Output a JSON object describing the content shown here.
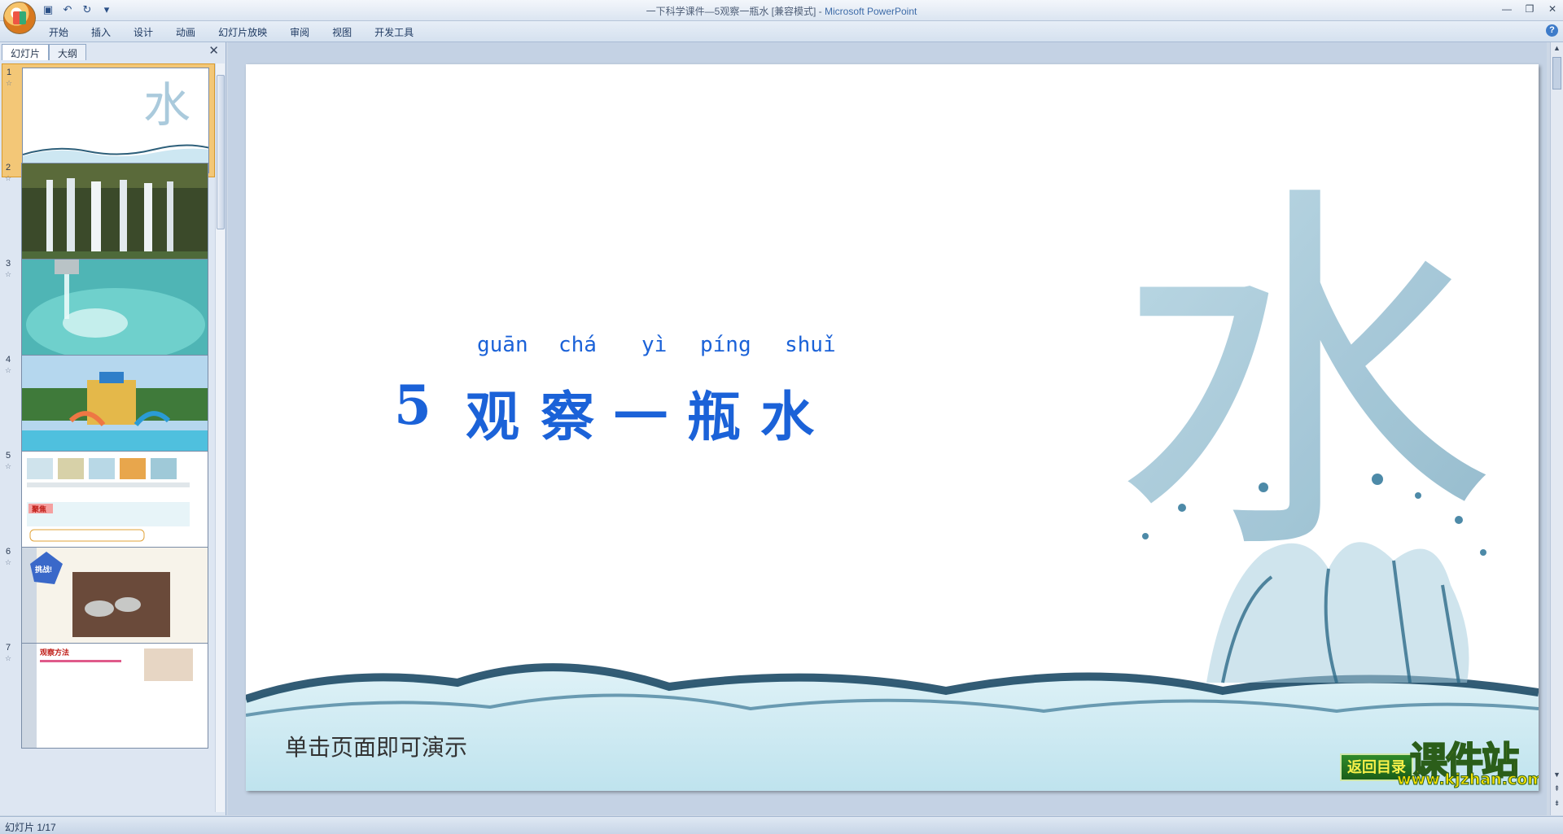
{
  "window": {
    "title": "一下科学课件—5观察一瓶水 [兼容模式] - ",
    "app_name": "Microsoft PowerPoint",
    "quick_access": [
      "save-icon",
      "undo-icon",
      "redo-icon",
      "customize-icon"
    ]
  },
  "ribbon": {
    "tabs": [
      "开始",
      "插入",
      "设计",
      "动画",
      "幻灯片放映",
      "审阅",
      "视图",
      "开发工具"
    ]
  },
  "left_pane": {
    "tabs": [
      "幻灯片",
      "大纲"
    ],
    "thumbnails": [
      {
        "num": "1",
        "label": "5 观察一瓶水"
      },
      {
        "num": "2",
        "label": ""
      },
      {
        "num": "3",
        "label": ""
      },
      {
        "num": "4",
        "label": ""
      },
      {
        "num": "5",
        "label": "聚焦"
      },
      {
        "num": "6",
        "label": "挑战!"
      },
      {
        "num": "7",
        "label": "观察方法"
      }
    ]
  },
  "slide": {
    "pinyin": [
      "guān",
      "chá",
      "yì",
      "píng",
      "shuǐ"
    ],
    "title_number": "5",
    "title_chars": [
      "观",
      "察",
      "一",
      "瓶",
      "水"
    ],
    "hint": "单击页面即可演示",
    "back_button": "返回目录",
    "watermark_top": "课件站",
    "watermark_bottom": "www.kjzhan.com",
    "accent_color": "#1b62d8"
  },
  "status": {
    "slide_info": "幻灯片 1/17"
  }
}
